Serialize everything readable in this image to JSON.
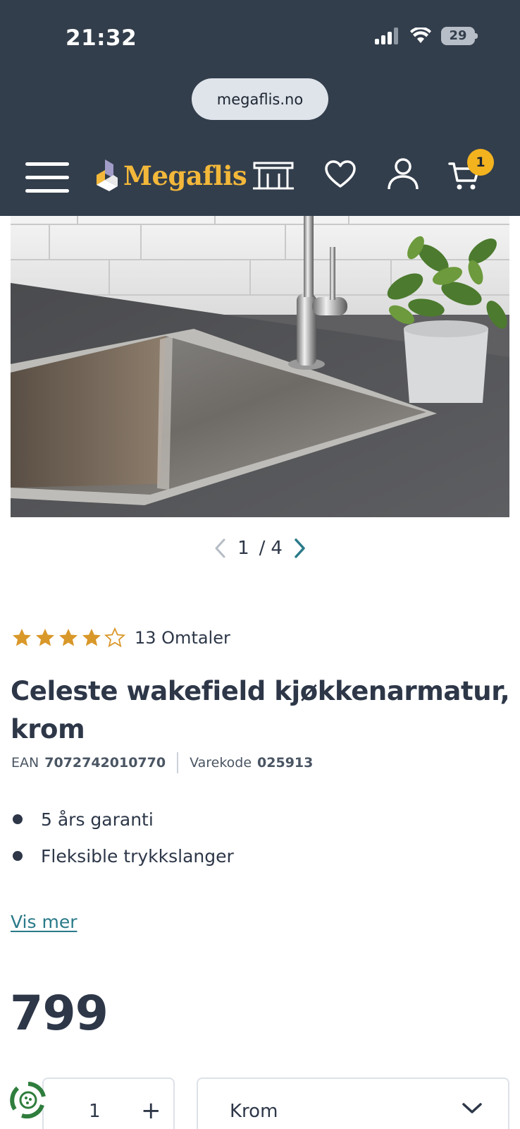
{
  "status_bar": {
    "time": "21:32",
    "battery": "29"
  },
  "browser": {
    "url": "megaflis.no"
  },
  "header": {
    "logo_text": "Megaflis",
    "cart_count": "1",
    "colors": {
      "background": "#333e4c",
      "logo": "#f3b83a",
      "badge": "#f3b31f"
    }
  },
  "gallery": {
    "current": "1",
    "separator": "/",
    "total": "4"
  },
  "product": {
    "rating": 4,
    "rating_max": 5,
    "review_count_label": "13 Omtaler",
    "title": "Celeste wakefield kjøkkenarmatur, krom",
    "ean_label": "EAN",
    "ean_value": "7072742010770",
    "code_label": "Varekode",
    "code_value": "025913",
    "features": [
      "5 års garanti",
      "Fleksible trykkslanger"
    ],
    "show_more_label": "Vis mer",
    "price": "799"
  },
  "purchase": {
    "quantity": "1",
    "plus_symbol": "+",
    "variant": "Krom"
  },
  "icons": {
    "menu": "hamburger-icon",
    "store": "store-icon",
    "wishlist": "heart-icon",
    "account": "user-icon",
    "cart": "cart-icon",
    "prev": "chevron-left-icon",
    "next": "chevron-right-icon",
    "dropdown": "chevron-down-icon"
  }
}
